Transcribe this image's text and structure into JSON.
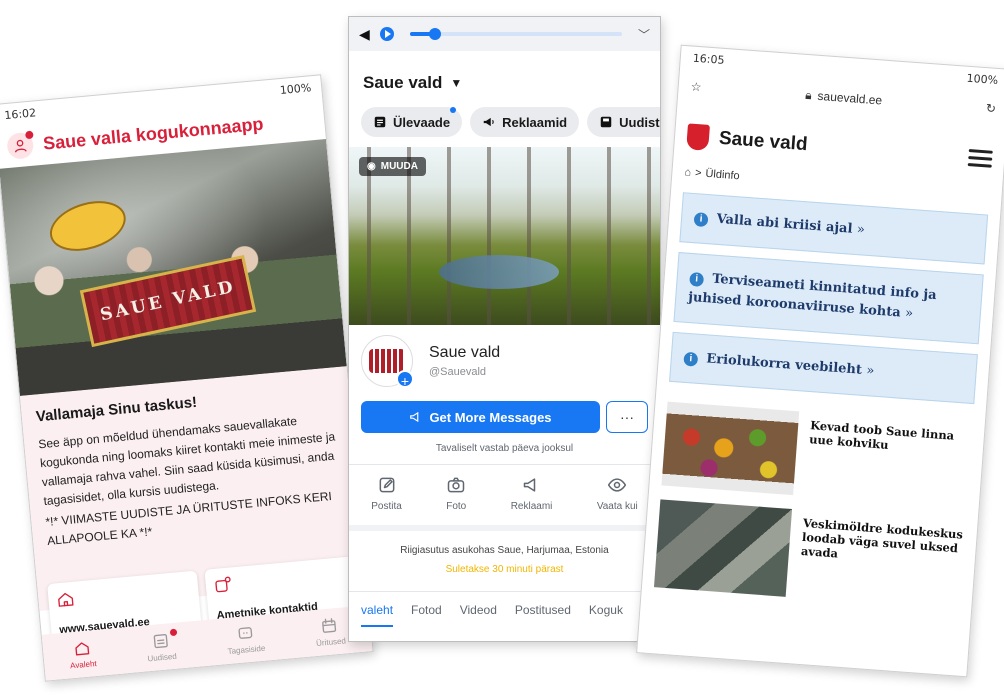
{
  "phone_app": {
    "status": {
      "time": "16:02",
      "battery": "100%"
    },
    "app_title": "Saue valla kogukonnaapp",
    "hero_banner_text": "SAUE VALD",
    "section_title": "Vallamaja Sinu taskus!",
    "description": "See äpp on mõeldud ühendamaks sauevallakate kogukonda ning loomaks kiiret kontakti meie inimeste ja vallamaja rahva vahel. Siin saad küsida küsimusi, anda tagasisidet, olla kursis  uudistega.",
    "notice": "*!* VIIMASTE UUDISTE JA ÜRITUSTE INFOKS KERI ALLAPOOLE KA *!*",
    "cards": [
      {
        "label": "www.sauevald.ee",
        "icon": "home-icon"
      },
      {
        "label": "Ametnike kontaktid",
        "icon": "contact-icon"
      }
    ],
    "nav": [
      {
        "label": "Avaleht",
        "icon": "home-icon",
        "active": true
      },
      {
        "label": "Uudised",
        "icon": "news-icon",
        "badge": true
      },
      {
        "label": "Tagasiside",
        "icon": "feedback-icon"
      },
      {
        "label": "Üritused",
        "icon": "calendar-icon"
      }
    ],
    "accent_color": "#d9203a"
  },
  "phone_facebook": {
    "page_name": "Saue vald",
    "tabs": [
      {
        "label": "Ülevaade",
        "icon": "overview-icon",
        "dot": true
      },
      {
        "label": "Reklaamid",
        "icon": "megaphone-icon"
      },
      {
        "label": "Uudistevo",
        "icon": "inbox-icon"
      }
    ],
    "cover_button": "MUUDA",
    "profile_name": "Saue vald",
    "profile_handle": "@Sauevald",
    "primary_button": "Get More Messages",
    "more_button": "···",
    "response_note": "Tavaliselt vastab päeva jooksul",
    "quick_actions": [
      {
        "label": "Postita",
        "icon": "edit-icon"
      },
      {
        "label": "Foto",
        "icon": "camera-icon"
      },
      {
        "label": "Reklaami",
        "icon": "megaphone-icon"
      },
      {
        "label": "Vaata kui",
        "icon": "eye-icon"
      }
    ],
    "about_line": "Riigiasutus asukohas Saue, Harjumaa, Estonia",
    "closing_note": "Suletakse 30 minuti pärast",
    "bottom_tabs": [
      "valeht",
      "Fotod",
      "Videod",
      "Postitused",
      "Koguk"
    ],
    "accent_color": "#1877f2",
    "media_progress": 0.12
  },
  "phone_web": {
    "status": {
      "time": "16:05",
      "battery": "100%"
    },
    "url": "sauevald.ee",
    "site_name": "Saue vald",
    "breadcrumb": "Üldinfo",
    "info_boxes": [
      {
        "text": "Valla abi kriisi ajal",
        "suffix": "»"
      },
      {
        "text": "Terviseameti kinnitatud info ja juhised koroonaviiruse kohta",
        "suffix": "»"
      },
      {
        "text": "Eriolukorra veebileht",
        "suffix": "»"
      }
    ],
    "news": [
      {
        "title": "Kevad toob Saue linna uue kohviku"
      },
      {
        "title": "Veskimöldre kodukeskus loodab väga suvel uksed avada"
      }
    ],
    "box_color": "#dcebf7"
  }
}
